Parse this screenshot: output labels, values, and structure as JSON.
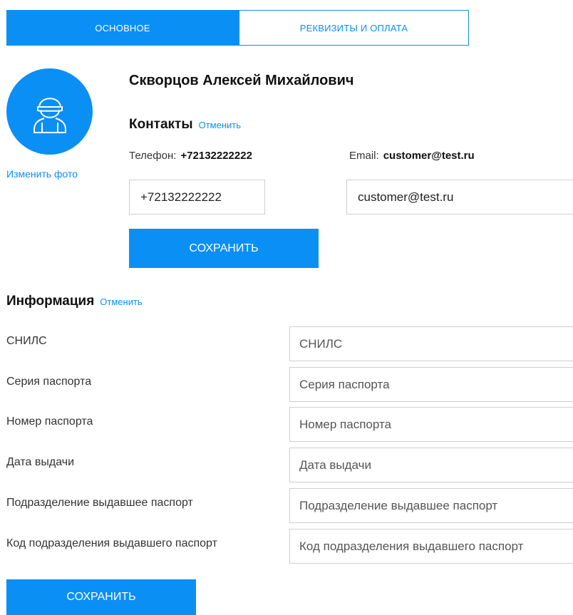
{
  "tabs": [
    {
      "label": "ОСНОВНОЕ",
      "active": true
    },
    {
      "label": "РЕКВИЗИТЫ И ОПЛАТА",
      "active": false
    }
  ],
  "profile": {
    "name": "Скворцов Алексей Михайлович",
    "change_photo": "Изменить фото",
    "avatar_icon": "user-icon"
  },
  "contacts": {
    "title": "Контакты",
    "cancel": "Отменить",
    "phone_label": "Телефон:",
    "phone_value": "+72132222222",
    "email_label": "Email:",
    "email_value": "customer@test.ru",
    "phone_input": "+72132222222",
    "email_input": "customer@test.ru",
    "save": "СОХРАНИТЬ"
  },
  "information": {
    "title": "Информация",
    "cancel": "Отменить",
    "fields": [
      {
        "label": "СНИЛС",
        "placeholder": "СНИЛС"
      },
      {
        "label": "Серия паспорта",
        "placeholder": "Серия паспорта"
      },
      {
        "label": "Номер паспорта",
        "placeholder": "Номер паспорта"
      },
      {
        "label": "Дата выдачи",
        "placeholder": "Дата выдачи"
      },
      {
        "label": "Подразделение выдавшее паспорт",
        "placeholder": "Подразделение выдавшее паспорт"
      },
      {
        "label": "Код подразделения выдавшего паспорт",
        "placeholder": "Код подразделения выдавшего паспорт"
      }
    ],
    "save": "СОХРАНИТЬ"
  },
  "colors": {
    "accent": "#0a8ff5",
    "border": "#cfcfcf"
  }
}
